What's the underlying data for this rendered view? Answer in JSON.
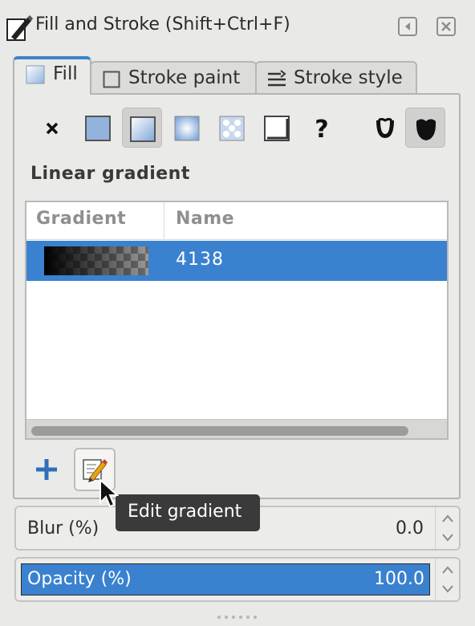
{
  "window": {
    "title": "Fill and Stroke (Shift+Ctrl+F)"
  },
  "tabs": [
    {
      "label": "Fill",
      "active": true,
      "icon": "fill-square-icon"
    },
    {
      "label": "Stroke paint",
      "active": false,
      "icon": "empty-square-icon"
    },
    {
      "label": "Stroke style",
      "active": false,
      "icon": "stroke-lines-icon"
    }
  ],
  "paint_modes": [
    {
      "icon": "no-paint-icon",
      "active": false
    },
    {
      "icon": "flat-color-icon",
      "active": false
    },
    {
      "icon": "linear-gradient-icon",
      "active": true
    },
    {
      "icon": "radial-gradient-icon",
      "active": false
    },
    {
      "icon": "pattern-icon",
      "active": false
    },
    {
      "icon": "swatch-icon",
      "active": false
    },
    {
      "icon": "unset-paint-icon",
      "active": false
    },
    {
      "icon": "fill-rule-evenodd-icon",
      "active": false
    },
    {
      "icon": "fill-rule-nonzero-icon",
      "active": true
    }
  ],
  "section": {
    "label": "Linear gradient"
  },
  "gradient_list": {
    "columns": [
      "Gradient",
      "Name"
    ],
    "rows": [
      {
        "name": "4138",
        "selected": true
      }
    ]
  },
  "actions": {
    "add_icon": "plus-icon",
    "edit_icon": "edit-gradient-icon",
    "tooltip": "Edit gradient"
  },
  "blur": {
    "label": "Blur (%)",
    "value": "0.0"
  },
  "opacity": {
    "label": "Opacity (%)",
    "value": "100.0"
  },
  "colors": {
    "accent": "#3a81d0",
    "background": "#e9e9e7"
  }
}
